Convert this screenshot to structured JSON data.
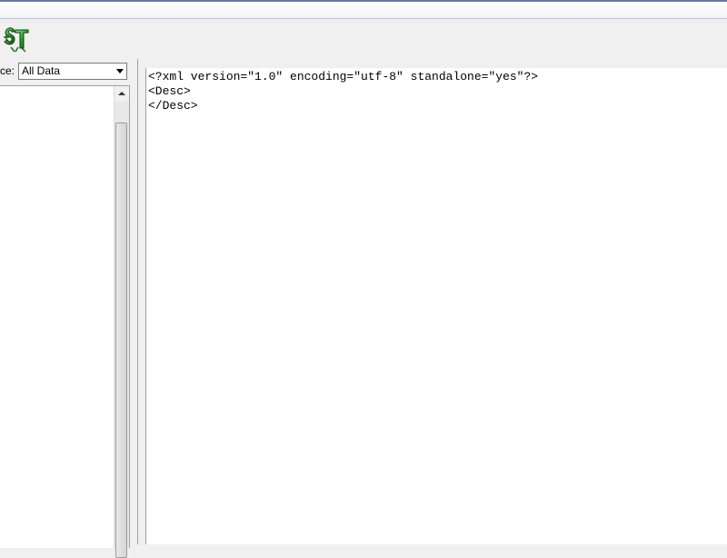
{
  "window": {
    "title": ""
  },
  "toolbar": {
    "app_icon": "app-logo-icon",
    "accent_color": "#2e8b2e"
  },
  "left_pane": {
    "source_label": "ce:",
    "source_select": {
      "value": "All Data"
    },
    "list_items": []
  },
  "editor": {
    "lines": [
      "<?xml version=\"1.0\" encoding=\"utf-8\" standalone=\"yes\"?>",
      "<Desc>",
      "</Desc>"
    ]
  }
}
